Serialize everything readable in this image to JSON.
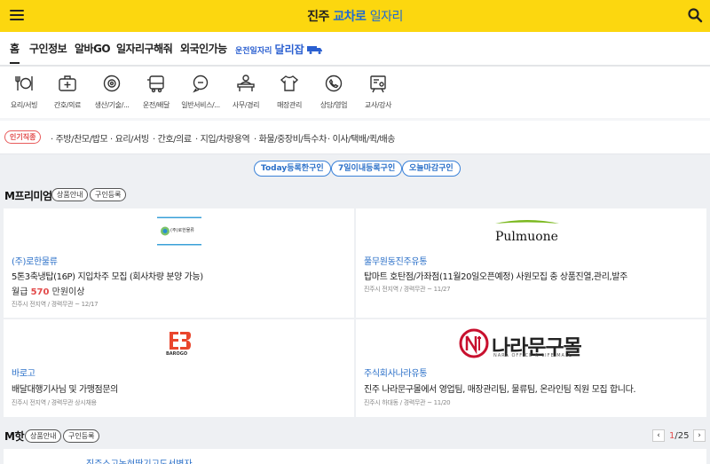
{
  "header": {
    "brand_prefix": "진주",
    "brand_mid": "교차로",
    "brand_suffix": "일자리"
  },
  "nav": {
    "tabs": [
      "홈",
      "구인정보",
      "알바GO",
      "일자리구해줘",
      "외국인가능"
    ],
    "ad_small": "운전일자리",
    "ad_big": "달리잡"
  },
  "categories": [
    {
      "label": "요리/서빙",
      "icon": "cutlery-icon"
    },
    {
      "label": "간호/의료",
      "icon": "medical-kit-icon"
    },
    {
      "label": "생산/기술/...",
      "icon": "gear-icon"
    },
    {
      "label": "운전/배달",
      "icon": "truck-icon"
    },
    {
      "label": "일반서비스/...",
      "icon": "chat-icon"
    },
    {
      "label": "사무/경리",
      "icon": "desk-icon"
    },
    {
      "label": "매장관리",
      "icon": "shirt-icon"
    },
    {
      "label": "상담/영업",
      "icon": "phone-icon"
    },
    {
      "label": "교사/강사",
      "icon": "board-icon"
    }
  ],
  "popular": {
    "badge": "인기직종",
    "keywords": [
      "주방/찬모/밥모",
      "요리/서빙",
      "간호/의료",
      "지입/차량용역",
      "화물/중장비/특수차",
      "이사/택배/퀵/배송"
    ]
  },
  "filters": [
    "Today등록한구인",
    "7일이내등록구인",
    "오늘마감구인"
  ],
  "premium": {
    "title": "M프리미엄",
    "chip_info": "상품안내",
    "chip_register": "구인등록",
    "cards": [
      {
        "logo_text": "(주)로한물류",
        "company": "(주)로한물류",
        "title": "5톤3축냉탑(16P) 지입차주 모집 (회사차량 분양 가능)",
        "salary_prefix": "월급",
        "salary_amount": "570",
        "salary_suffix": "만원이상",
        "meta": "진주시 전지역 / 경력무관 ~ 12/17"
      },
      {
        "logo_text": "Pulmuone",
        "company": "풀무원동진주유통",
        "title": "탑마트 호탄점/가좌점(11월20일오픈예정) 사원모집 충 상품진열,관리,발주",
        "meta": "진주시 전지역 / 경력무관 ~ 11/27"
      },
      {
        "logo_text": "BAROGO",
        "company": "바로고",
        "title": "배달대행기사님 및 가맹점문의",
        "meta": "진주시 전지역 / 경력무관 상시채용"
      },
      {
        "logo_text": "나라문구몰",
        "logo_sub": "NARA OFFICE & LIFE MALL",
        "company": "주식회사나라유통",
        "title": "진주 나라문구몰에서 영업팀, 매장관리팀, 물류팀, 온라인팀 직원 모집 합니다.",
        "meta": "진주시 하대동 / 경력무관 ~ 11/20"
      }
    ]
  },
  "hot": {
    "title": "M핫",
    "chip_info": "상품안내",
    "chip_register": "구인등록",
    "page_current": "1",
    "page_total": "/25",
    "next_company": "진주스고녹혀땅기고도서변자"
  },
  "colors": {
    "brand_yellow": "#fcd70f",
    "link_blue": "#2a6fc8",
    "accent_red": "#e24b4b"
  }
}
